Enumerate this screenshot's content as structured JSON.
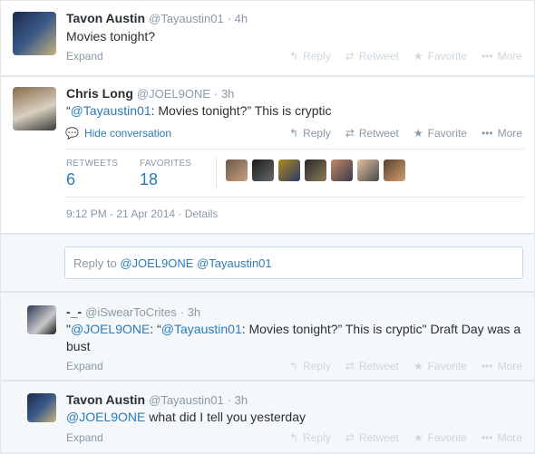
{
  "tweets": [
    {
      "name": "Tavon Austin",
      "handle": "@Tayaustin01",
      "time": "· 4h",
      "text": "Movies tonight?",
      "expand": "Expand"
    },
    {
      "name": "Chris Long",
      "handle": "@JOEL9ONE",
      "time": "· 3h",
      "text_prefix": "“",
      "text_mention": "@Tayaustin01",
      "text_rest": ": Movies tonight?” This is cryptic",
      "hide": "Hide conversation",
      "stats": {
        "retweets_label": "RETWEETS",
        "retweets": "6",
        "favorites_label": "FAVORITES",
        "favorites": "18"
      },
      "timestamp": "9:12 PM - 21 Apr 2014",
      "details": "· Details"
    },
    {
      "name": "-_-",
      "handle": "@iSwearToCrites",
      "time": "· 3h",
      "line1_prefix": "\"",
      "line1_mention1": "@JOEL9ONE",
      "line1_mid": ": “",
      "line1_mention2": "@Tayaustin01",
      "line1_rest": ": Movies tonight?” This is cryptic\" Draft Day was a",
      "line2": "bust",
      "expand": "Expand"
    },
    {
      "name": "Tavon Austin",
      "handle": "@Tayaustin01",
      "time": "· 3h",
      "text_mention": "@JOEL9ONE",
      "text_rest": " what did I tell you yesterday",
      "expand": "Expand"
    }
  ],
  "actions": {
    "reply": "Reply",
    "retweet": "Retweet",
    "favorite": "Favorite",
    "more": "More"
  },
  "reply_box": {
    "prefix": "Reply to ",
    "mention1": "@JOEL9ONE",
    "mention2": "@Tayaustin01"
  },
  "icons": {
    "reply": "reply-arrow-icon",
    "retweet": "retweet-icon",
    "favorite": "star-icon",
    "more": "ellipsis-icon",
    "conversation": "speech-bubble-icon"
  },
  "colors": {
    "link": "#2b7bb9",
    "muted": "#8899a6",
    "background": "#e8edf1"
  }
}
